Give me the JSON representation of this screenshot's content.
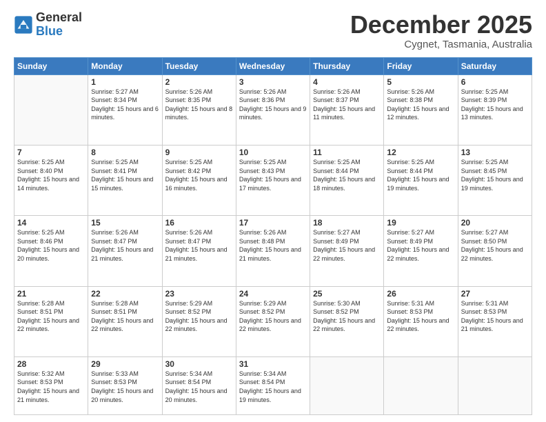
{
  "logo": {
    "general": "General",
    "blue": "Blue"
  },
  "header": {
    "month": "December 2025",
    "location": "Cygnet, Tasmania, Australia"
  },
  "weekdays": [
    "Sunday",
    "Monday",
    "Tuesday",
    "Wednesday",
    "Thursday",
    "Friday",
    "Saturday"
  ],
  "weeks": [
    [
      {
        "day": "",
        "info": ""
      },
      {
        "day": "1",
        "info": "Sunrise: 5:27 AM\nSunset: 8:34 PM\nDaylight: 15 hours\nand 6 minutes."
      },
      {
        "day": "2",
        "info": "Sunrise: 5:26 AM\nSunset: 8:35 PM\nDaylight: 15 hours\nand 8 minutes."
      },
      {
        "day": "3",
        "info": "Sunrise: 5:26 AM\nSunset: 8:36 PM\nDaylight: 15 hours\nand 9 minutes."
      },
      {
        "day": "4",
        "info": "Sunrise: 5:26 AM\nSunset: 8:37 PM\nDaylight: 15 hours\nand 11 minutes."
      },
      {
        "day": "5",
        "info": "Sunrise: 5:26 AM\nSunset: 8:38 PM\nDaylight: 15 hours\nand 12 minutes."
      },
      {
        "day": "6",
        "info": "Sunrise: 5:25 AM\nSunset: 8:39 PM\nDaylight: 15 hours\nand 13 minutes."
      }
    ],
    [
      {
        "day": "7",
        "info": "Sunrise: 5:25 AM\nSunset: 8:40 PM\nDaylight: 15 hours\nand 14 minutes."
      },
      {
        "day": "8",
        "info": "Sunrise: 5:25 AM\nSunset: 8:41 PM\nDaylight: 15 hours\nand 15 minutes."
      },
      {
        "day": "9",
        "info": "Sunrise: 5:25 AM\nSunset: 8:42 PM\nDaylight: 15 hours\nand 16 minutes."
      },
      {
        "day": "10",
        "info": "Sunrise: 5:25 AM\nSunset: 8:43 PM\nDaylight: 15 hours\nand 17 minutes."
      },
      {
        "day": "11",
        "info": "Sunrise: 5:25 AM\nSunset: 8:44 PM\nDaylight: 15 hours\nand 18 minutes."
      },
      {
        "day": "12",
        "info": "Sunrise: 5:25 AM\nSunset: 8:44 PM\nDaylight: 15 hours\nand 19 minutes."
      },
      {
        "day": "13",
        "info": "Sunrise: 5:25 AM\nSunset: 8:45 PM\nDaylight: 15 hours\nand 19 minutes."
      }
    ],
    [
      {
        "day": "14",
        "info": "Sunrise: 5:25 AM\nSunset: 8:46 PM\nDaylight: 15 hours\nand 20 minutes."
      },
      {
        "day": "15",
        "info": "Sunrise: 5:26 AM\nSunset: 8:47 PM\nDaylight: 15 hours\nand 21 minutes."
      },
      {
        "day": "16",
        "info": "Sunrise: 5:26 AM\nSunset: 8:47 PM\nDaylight: 15 hours\nand 21 minutes."
      },
      {
        "day": "17",
        "info": "Sunrise: 5:26 AM\nSunset: 8:48 PM\nDaylight: 15 hours\nand 21 minutes."
      },
      {
        "day": "18",
        "info": "Sunrise: 5:27 AM\nSunset: 8:49 PM\nDaylight: 15 hours\nand 22 minutes."
      },
      {
        "day": "19",
        "info": "Sunrise: 5:27 AM\nSunset: 8:49 PM\nDaylight: 15 hours\nand 22 minutes."
      },
      {
        "day": "20",
        "info": "Sunrise: 5:27 AM\nSunset: 8:50 PM\nDaylight: 15 hours\nand 22 minutes."
      }
    ],
    [
      {
        "day": "21",
        "info": "Sunrise: 5:28 AM\nSunset: 8:51 PM\nDaylight: 15 hours\nand 22 minutes."
      },
      {
        "day": "22",
        "info": "Sunrise: 5:28 AM\nSunset: 8:51 PM\nDaylight: 15 hours\nand 22 minutes."
      },
      {
        "day": "23",
        "info": "Sunrise: 5:29 AM\nSunset: 8:52 PM\nDaylight: 15 hours\nand 22 minutes."
      },
      {
        "day": "24",
        "info": "Sunrise: 5:29 AM\nSunset: 8:52 PM\nDaylight: 15 hours\nand 22 minutes."
      },
      {
        "day": "25",
        "info": "Sunrise: 5:30 AM\nSunset: 8:52 PM\nDaylight: 15 hours\nand 22 minutes."
      },
      {
        "day": "26",
        "info": "Sunrise: 5:31 AM\nSunset: 8:53 PM\nDaylight: 15 hours\nand 22 minutes."
      },
      {
        "day": "27",
        "info": "Sunrise: 5:31 AM\nSunset: 8:53 PM\nDaylight: 15 hours\nand 21 minutes."
      }
    ],
    [
      {
        "day": "28",
        "info": "Sunrise: 5:32 AM\nSunset: 8:53 PM\nDaylight: 15 hours\nand 21 minutes."
      },
      {
        "day": "29",
        "info": "Sunrise: 5:33 AM\nSunset: 8:53 PM\nDaylight: 15 hours\nand 20 minutes."
      },
      {
        "day": "30",
        "info": "Sunrise: 5:34 AM\nSunset: 8:54 PM\nDaylight: 15 hours\nand 20 minutes."
      },
      {
        "day": "31",
        "info": "Sunrise: 5:34 AM\nSunset: 8:54 PM\nDaylight: 15 hours\nand 19 minutes."
      },
      {
        "day": "",
        "info": ""
      },
      {
        "day": "",
        "info": ""
      },
      {
        "day": "",
        "info": ""
      }
    ]
  ]
}
